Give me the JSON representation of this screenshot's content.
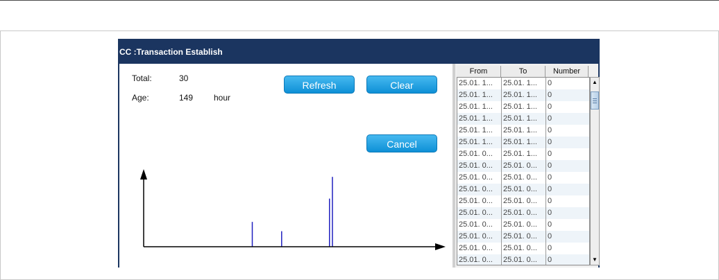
{
  "dialog": {
    "title": "CC :Transaction Establish"
  },
  "stats": {
    "total_label": "Total:",
    "total_value": "30",
    "age_label": "Age:",
    "age_value": "149",
    "age_unit": "hour"
  },
  "buttons": {
    "refresh": "Refresh",
    "clear": "Clear",
    "cancel": "Cancel"
  },
  "chart_data": {
    "type": "bar",
    "title": "",
    "xlabel": "",
    "ylabel": "",
    "bars": [
      {
        "x": 0.37,
        "value": 0.32
      },
      {
        "x": 0.47,
        "value": 0.2
      },
      {
        "x": 0.633,
        "value": 0.62
      },
      {
        "x": 0.643,
        "value": 0.9
      }
    ],
    "bar_color": "#1f1fbf"
  },
  "table": {
    "columns": [
      "From",
      "To",
      "Number"
    ],
    "rows": [
      [
        "25.01. 1...",
        "25.01. 1...",
        "0"
      ],
      [
        "25.01. 1...",
        "25.01. 1...",
        "0"
      ],
      [
        "25.01. 1...",
        "25.01. 1...",
        "0"
      ],
      [
        "25.01. 1...",
        "25.01. 1...",
        "0"
      ],
      [
        "25.01. 1...",
        "25.01. 1...",
        "0"
      ],
      [
        "25.01. 1...",
        "25.01. 1...",
        "0"
      ],
      [
        "25.01. 0...",
        "25.01. 1...",
        "0"
      ],
      [
        "25.01. 0...",
        "25.01. 0...",
        "0"
      ],
      [
        "25.01. 0...",
        "25.01. 0...",
        "0"
      ],
      [
        "25.01. 0...",
        "25.01. 0...",
        "0"
      ],
      [
        "25.01. 0...",
        "25.01. 0...",
        "0"
      ],
      [
        "25.01. 0...",
        "25.01. 0...",
        "0"
      ],
      [
        "25.01. 0...",
        "25.01. 0...",
        "0"
      ],
      [
        "25.01. 0...",
        "25.01. 0...",
        "0"
      ],
      [
        "25.01. 0...",
        "25.01. 0...",
        "0"
      ],
      [
        "25.01. 0...",
        "25.01. 0...",
        "0"
      ]
    ]
  },
  "colors": {
    "titlebar": "#1b3560",
    "button": "#1aa0e6",
    "axis": "#000000"
  }
}
